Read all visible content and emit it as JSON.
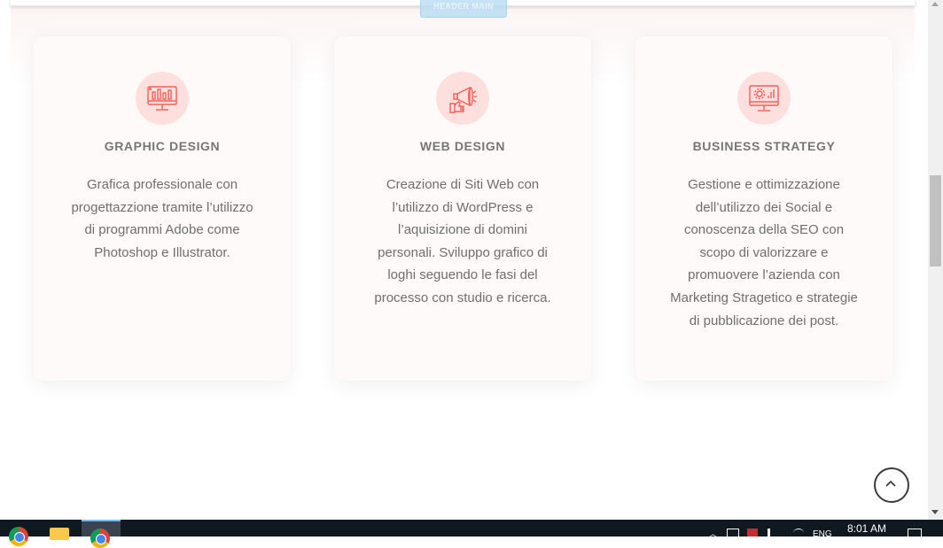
{
  "header": {
    "tag_label": "HEADER MAIN"
  },
  "services": [
    {
      "icon": "monitor-chart-icon",
      "title": "GRAPHIC DESIGN",
      "description": "Grafica professionale con progettazzione tramite l’utilizzo di programmi Adobe come Photoshop e Illustrator."
    },
    {
      "icon": "megaphone-icon",
      "title": "WEB DESIGN",
      "description": "Creazione di Siti Web con l’utilizzo di WordPress e l’aquisizione di domini personali. Sviluppo grafico di loghi seguendo le fasi del processo con studio e ricerca."
    },
    {
      "icon": "monitor-gear-icon",
      "title": "BUSINESS STRATEGY",
      "description": "Gestione e ottimizzazione dell’utilizzo dei Social e conoscenza della SEO con scopo di valorizzare e promuovere l’azienda con Marketing Stragetico e strategie di pubblicazione dei post."
    }
  ],
  "back_to_top": {
    "icon": "chevron-up-icon"
  },
  "taskbar": {
    "apps": [
      "chrome-icon",
      "file-explorer-icon",
      "chrome-icon"
    ],
    "language": "ENG",
    "time": "8:01 AM"
  },
  "colors": {
    "accent": "#f0605a",
    "icon_bg": "#fde0de",
    "text": "#6e6e6e"
  }
}
